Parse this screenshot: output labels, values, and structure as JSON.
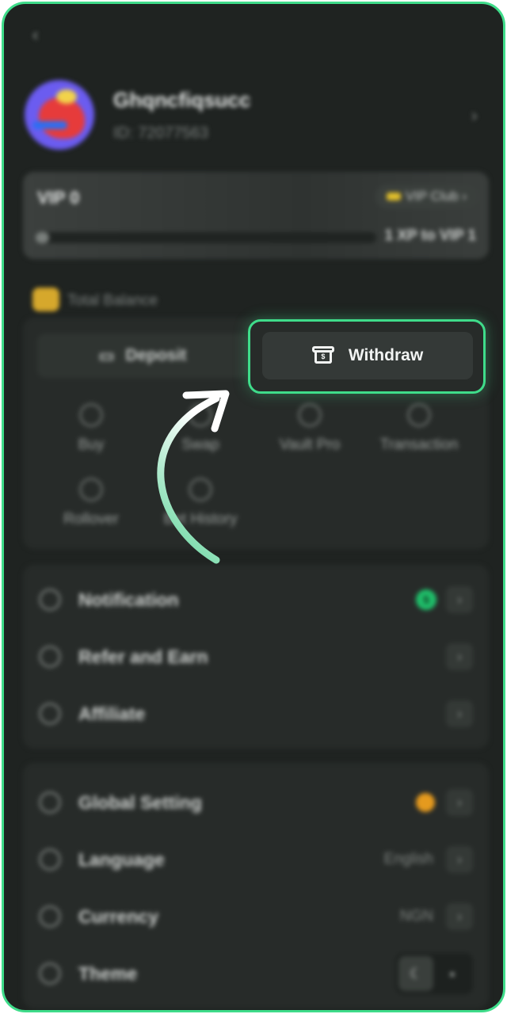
{
  "header": {
    "back_icon": "‹"
  },
  "profile": {
    "username": "Ghqncfiqsucc",
    "user_id": "ID: 72077563",
    "chevron": "›"
  },
  "vip": {
    "level": "VIP 0",
    "club_label": "VIP Club",
    "progress_text": "1 XP to VIP 1",
    "progress_fraction": 0.0
  },
  "balance": {
    "label": "Total Balance"
  },
  "actions": {
    "deposit_label": "Deposit",
    "withdraw_label": "Withdraw",
    "grid": [
      {
        "label": "Buy",
        "icon": "coin-icon"
      },
      {
        "label": "Swap",
        "icon": "swap-icon"
      },
      {
        "label": "Vault Pro",
        "icon": "vault-icon"
      },
      {
        "label": "Transaction",
        "icon": "transaction-icon"
      },
      {
        "label": "Rollover",
        "icon": "rollover-icon"
      },
      {
        "label": "Bet History",
        "icon": "clock-icon"
      }
    ]
  },
  "menu_primary": [
    {
      "label": "Notification",
      "badge": "5",
      "icon": "bell-icon"
    },
    {
      "label": "Refer and Earn",
      "icon": "users-icon"
    },
    {
      "label": "Affiliate",
      "icon": "affiliate-icon"
    }
  ],
  "menu_settings": [
    {
      "label": "Global Setting",
      "icon": "gear-icon"
    },
    {
      "label": "Language",
      "value": "English",
      "icon": "globe-icon"
    },
    {
      "label": "Currency",
      "value": "NGN",
      "icon": "currency-icon"
    },
    {
      "label": "Theme",
      "icon": "theme-icon"
    }
  ],
  "colors": {
    "highlight": "#3fdc8a",
    "background": "#1f2321",
    "badge_green": "#1fc16b",
    "dot_orange": "#e59a1e"
  }
}
